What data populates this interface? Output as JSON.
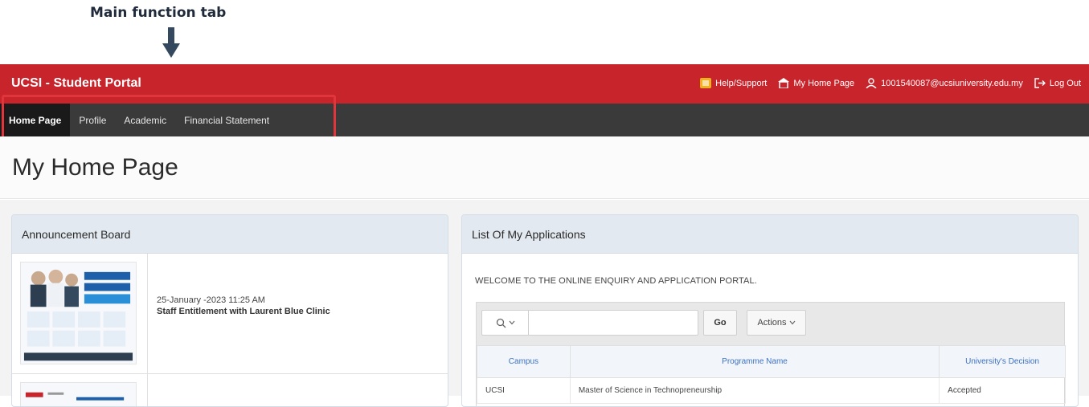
{
  "annotation": {
    "label": "Main function tab"
  },
  "header": {
    "brand": "UCSI - Student Portal",
    "links": [
      {
        "icon": "help-icon",
        "label": "Help/Support"
      },
      {
        "icon": "home-icon",
        "label": "My Home Page"
      },
      {
        "icon": "user-icon",
        "label": "1001540087@ucsiuniversity.edu.my"
      },
      {
        "icon": "logout-icon",
        "label": "Log Out"
      }
    ]
  },
  "nav": {
    "tabs": [
      {
        "label": "Home Page",
        "active": true
      },
      {
        "label": "Profile",
        "active": false
      },
      {
        "label": "Academic",
        "active": false
      },
      {
        "label": "Financial Statement",
        "active": false
      }
    ]
  },
  "page": {
    "title": "My Home Page"
  },
  "announcements": {
    "title": "Announcement Board",
    "items": [
      {
        "date": "25-January -2023 11:25 AM",
        "title": "Staff Entitlement with Laurent Blue Clinic",
        "poster_text": "Laurent Bleu Medical Clinic"
      },
      {
        "date": "",
        "title": ""
      }
    ]
  },
  "applications": {
    "title": "List Of My Applications",
    "welcome": "WELCOME TO THE ONLINE ENQUIRY AND APPLICATION PORTAL.",
    "search": {
      "selector_icon": "search-icon",
      "value": "",
      "placeholder": ""
    },
    "go_label": "Go",
    "actions_label": "Actions",
    "columns": [
      "Campus",
      "Programme Name",
      "University's Decision"
    ],
    "rows": [
      [
        "UCSI",
        "Master of Science in Technopreneurship",
        "Accepted"
      ]
    ]
  },
  "colors": {
    "brand_red": "#c8242b",
    "nav_dark": "#3a3a3a",
    "highlight_red": "#e0353b",
    "link_blue": "#3c72c4"
  }
}
